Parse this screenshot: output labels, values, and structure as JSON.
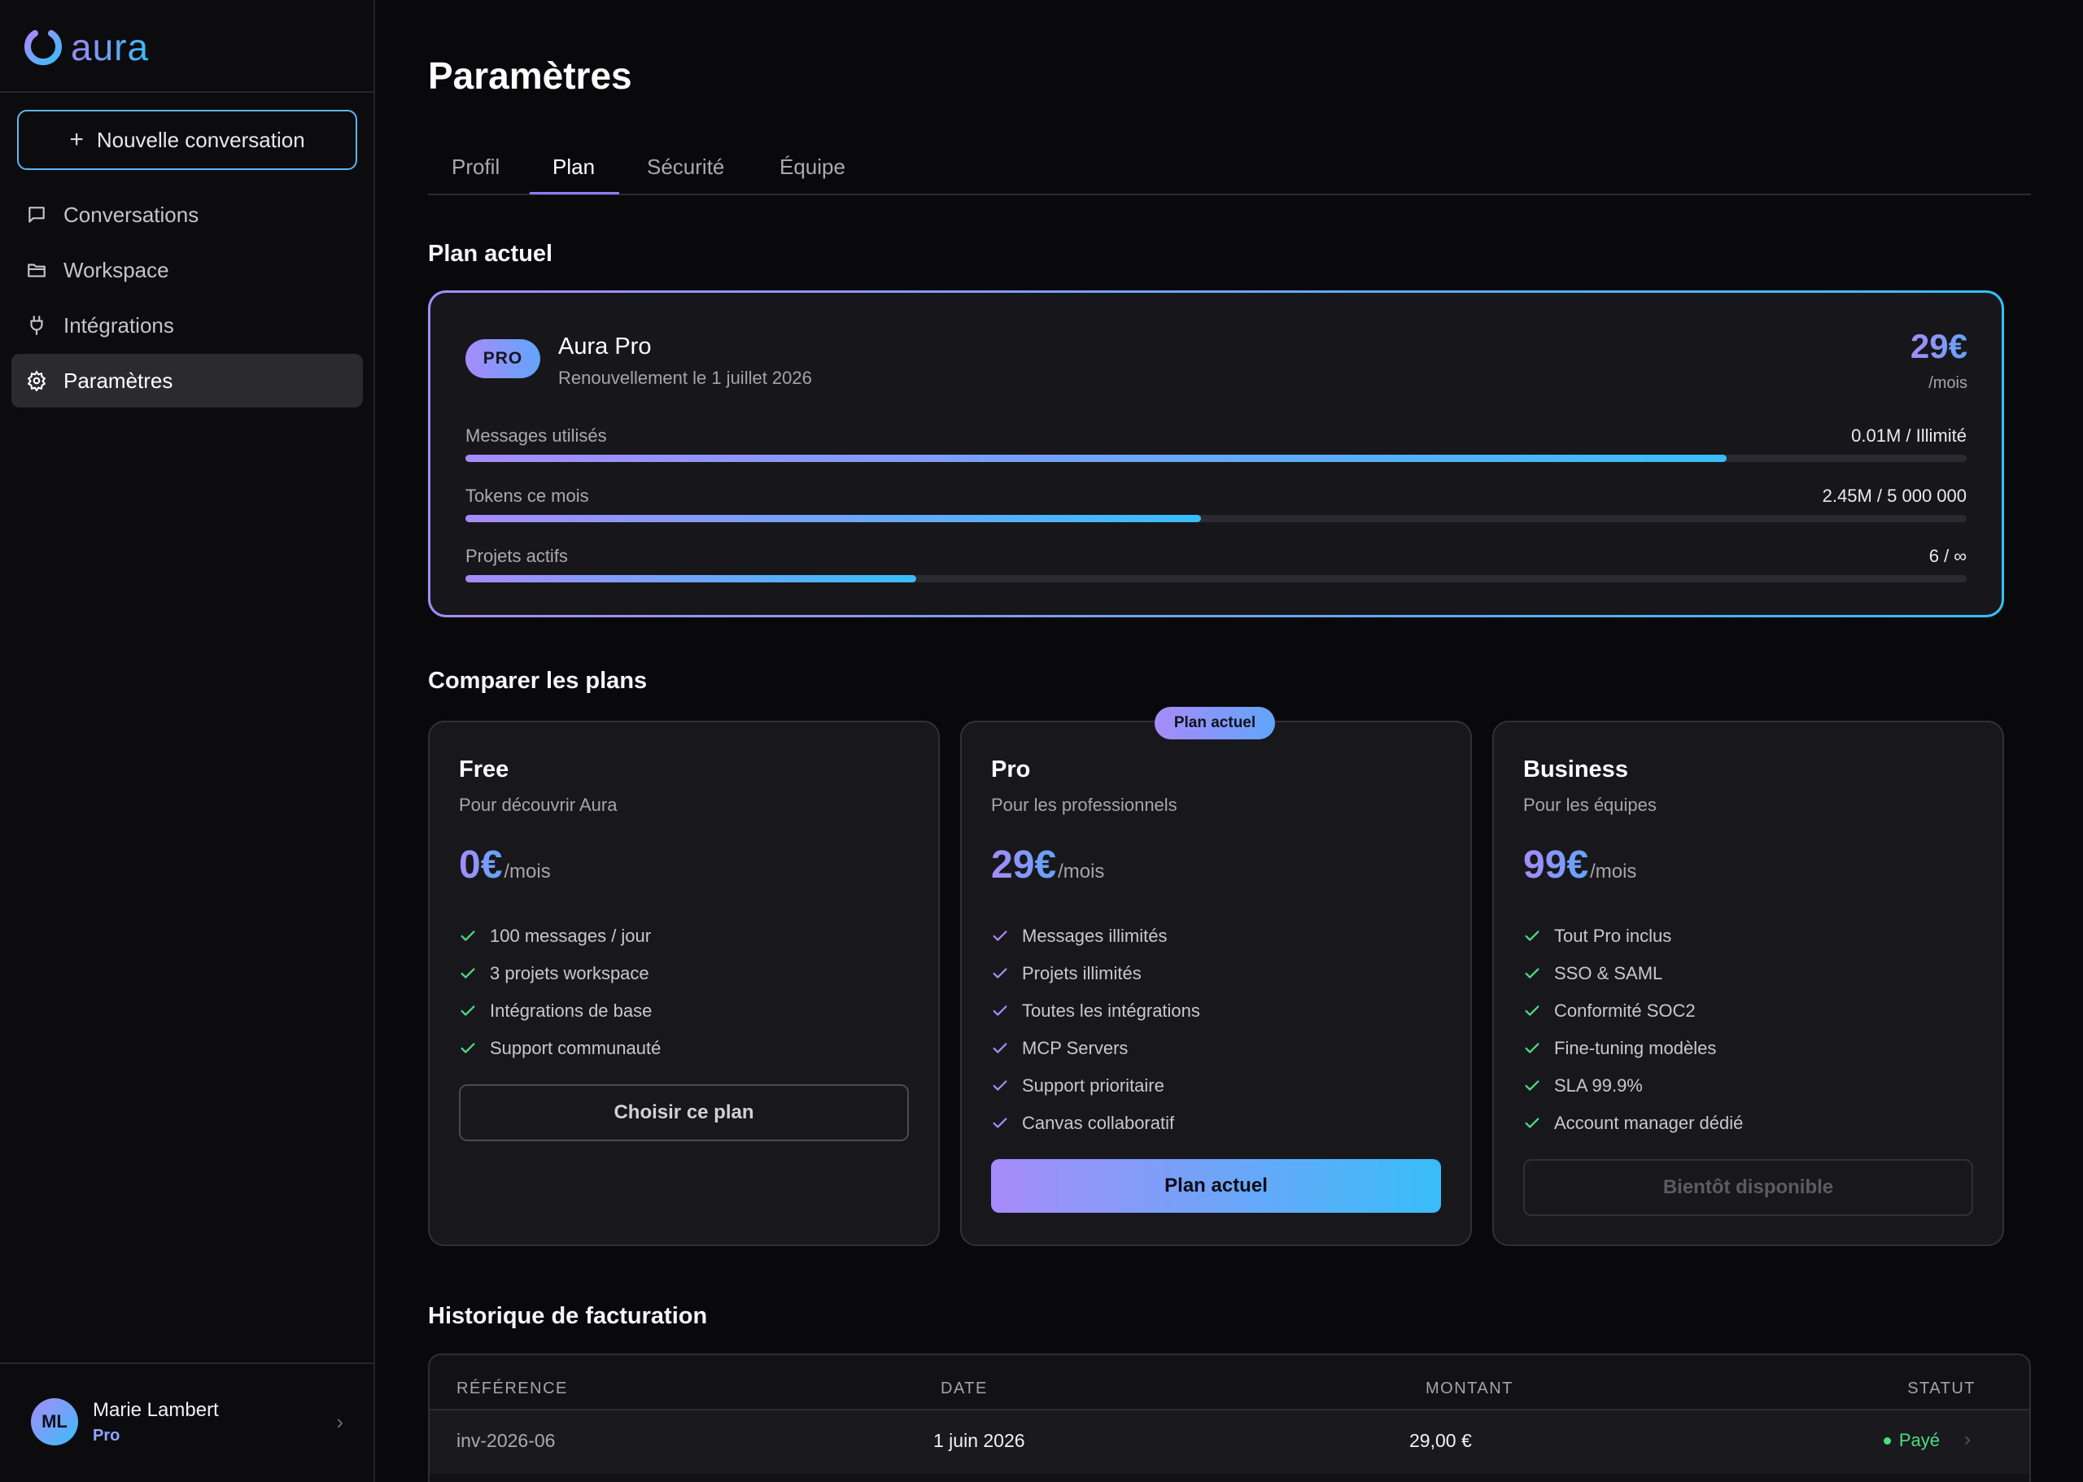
{
  "brand": {
    "name": "aura"
  },
  "sidebar": {
    "new_conversation": "Nouvelle conversation",
    "items": [
      {
        "label": "Conversations",
        "icon": "chat-bubble-icon",
        "active": false
      },
      {
        "label": "Workspace",
        "icon": "folder-icon",
        "active": false
      },
      {
        "label": "Intégrations",
        "icon": "plug-icon",
        "active": false
      },
      {
        "label": "Paramètres",
        "icon": "gear-icon",
        "active": true
      }
    ],
    "user": {
      "initials": "ML",
      "name": "Marie Lambert",
      "plan": "Pro"
    }
  },
  "page": {
    "title": "Paramètres"
  },
  "tabs": [
    {
      "label": "Profil",
      "active": false
    },
    {
      "label": "Plan",
      "active": true
    },
    {
      "label": "Sécurité",
      "active": false
    },
    {
      "label": "Équipe",
      "active": false
    }
  ],
  "current_plan": {
    "section_title": "Plan actuel",
    "badge": "PRO",
    "name": "Aura Pro",
    "renewal": "Renouvellement le 1 juillet 2026",
    "price": "29€",
    "period": "/mois",
    "usage": [
      {
        "label": "Messages utilisés",
        "value": "0.01M / Illimité",
        "fill_percent": 84
      },
      {
        "label": "Tokens ce mois",
        "value": "2.45M / 5 000 000",
        "fill_percent": 49
      },
      {
        "label": "Projets actifs",
        "value": "6 / ∞",
        "fill_percent": 30
      }
    ]
  },
  "compare": {
    "section_title": "Comparer les plans",
    "current_tag": "Plan actuel",
    "plans": [
      {
        "name": "Free",
        "description": "Pour découvrir Aura",
        "price": "0€",
        "period": "/mois",
        "features": [
          "100 messages / jour",
          "3 projets workspace",
          "Intégrations de base",
          "Support communauté"
        ],
        "button": "Choisir ce plan"
      },
      {
        "name": "Pro",
        "description": "Pour les professionnels",
        "price": "29€",
        "period": "/mois",
        "features": [
          "Messages illimités",
          "Projets illimités",
          "Toutes les intégrations",
          "MCP Servers",
          "Support prioritaire",
          "Canvas collaboratif"
        ],
        "button": "Plan actuel"
      },
      {
        "name": "Business",
        "description": "Pour les équipes",
        "price": "99€",
        "period": "/mois",
        "features": [
          "Tout Pro inclus",
          "SSO & SAML",
          "Conformité SOC2",
          "Fine-tuning modèles",
          "SLA 99.9%",
          "Account manager dédié"
        ],
        "button": "Bientôt disponible"
      }
    ]
  },
  "billing": {
    "section_title": "Historique de facturation",
    "columns": [
      "RÉFÉRENCE",
      "DATE",
      "MONTANT",
      "STATUT"
    ],
    "rows": [
      {
        "reference": "inv-2026-06",
        "date": "1 juin 2026",
        "amount": "29,00 €",
        "status": "Payé"
      }
    ]
  },
  "colors": {
    "accent_start": "#a78bfa",
    "accent_end": "#38bdf8",
    "success": "#4ade80",
    "background": "#09090c",
    "card": "#18181c"
  }
}
